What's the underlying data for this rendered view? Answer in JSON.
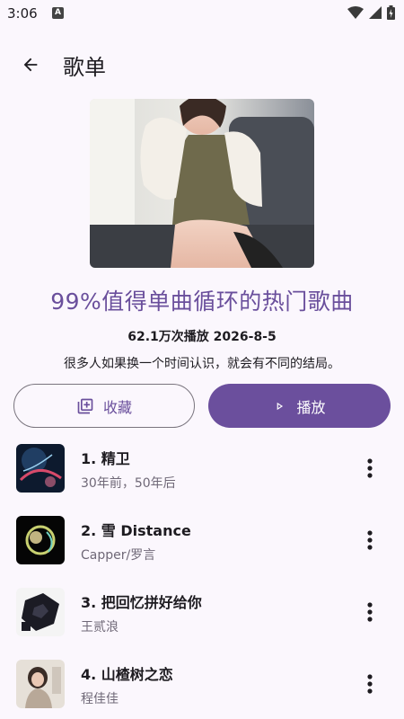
{
  "status_bar": {
    "time": "3:06",
    "notification_glyph": "A"
  },
  "app_bar": {
    "title": "歌单",
    "back_icon": "arrow-back-icon"
  },
  "playlist": {
    "title": "99%值得单曲循环的热门歌曲",
    "meta": "62.1万次播放 2026-8-5",
    "description": "很多人如果换一个时间认识，就会有不同的结局。"
  },
  "actions": {
    "collect_label": "收藏",
    "play_label": "播放"
  },
  "songs": [
    {
      "title": "1. 精卫",
      "subtitle": "30年前，50年后"
    },
    {
      "title": "2. 雪 Distance",
      "subtitle": "Capper/罗言"
    },
    {
      "title": "3. 把回忆拼好给你",
      "subtitle": "王贰浪"
    },
    {
      "title": "4. 山楂树之恋",
      "subtitle": "程佳佳"
    }
  ],
  "colors": {
    "background": "#fbf7fd",
    "accent": "#6b4f9d",
    "title_text": "#6a4f9c",
    "secondary_text": "#6f6877"
  }
}
